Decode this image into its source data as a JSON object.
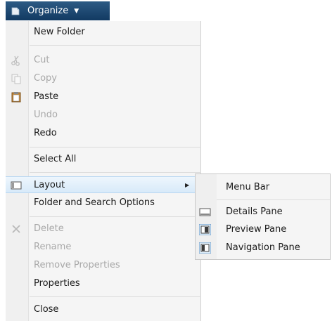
{
  "toolbar": {
    "organize_label": "Organize",
    "organize_icon": "organize-icon",
    "chevron": "▼"
  },
  "menu": {
    "items": [
      {
        "label": "New Folder",
        "enabled": true,
        "icon": null
      },
      {
        "label": "Cut",
        "enabled": false,
        "icon": "cut-icon"
      },
      {
        "label": "Copy",
        "enabled": false,
        "icon": "copy-icon"
      },
      {
        "label": "Paste",
        "enabled": true,
        "icon": "paste-icon"
      },
      {
        "label": "Undo",
        "enabled": false,
        "icon": null
      },
      {
        "label": "Redo",
        "enabled": true,
        "icon": null
      },
      {
        "label": "Select All",
        "enabled": true,
        "icon": null
      },
      {
        "label": "Layout",
        "enabled": true,
        "icon": "layout-icon",
        "submenu": true,
        "highlighted": true
      },
      {
        "label": "Folder and Search Options",
        "enabled": true,
        "icon": null
      },
      {
        "label": "Delete",
        "enabled": false,
        "icon": "delete-icon"
      },
      {
        "label": "Rename",
        "enabled": false,
        "icon": null
      },
      {
        "label": "Remove Properties",
        "enabled": false,
        "icon": null
      },
      {
        "label": "Properties",
        "enabled": true,
        "icon": null
      },
      {
        "label": "Close",
        "enabled": true,
        "icon": null
      }
    ],
    "submenu_arrow": "▶"
  },
  "submenu": {
    "items": [
      {
        "label": "Menu Bar",
        "icon": null
      },
      {
        "label": "Details Pane",
        "icon": "details-pane-icon"
      },
      {
        "label": "Preview Pane",
        "icon": "preview-pane-icon",
        "checked": true
      },
      {
        "label": "Navigation Pane",
        "icon": "navigation-pane-icon",
        "checked": true
      }
    ]
  },
  "colors": {
    "toolbar_bg": "#1d4570",
    "menu_bg": "#f5f5f5",
    "highlight": "#d8eaf9",
    "disabled_text": "#a8a8a8"
  }
}
